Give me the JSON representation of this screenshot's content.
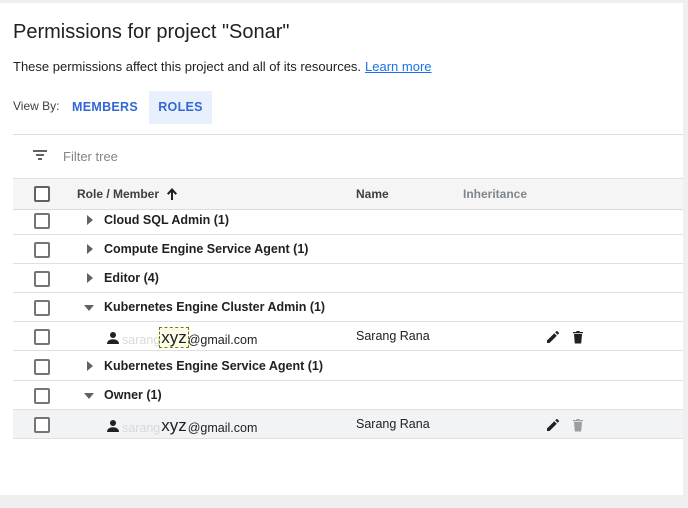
{
  "page": {
    "title": "Permissions for project \"Sonar\"",
    "subtitle": "These permissions affect this project and all of its resources.",
    "learn_more": "Learn more"
  },
  "view_by": {
    "label": "View By:",
    "tabs": [
      "MEMBERS",
      "ROLES"
    ],
    "selected": "ROLES"
  },
  "filter": {
    "placeholder": "Filter tree"
  },
  "table": {
    "columns": [
      "Role / Member",
      "Name",
      "Inheritance"
    ],
    "sort": {
      "column": "Role / Member",
      "direction": "ascending",
      "icon": "arrow-up-icon"
    }
  },
  "rows": [
    {
      "type": "role",
      "label": "Cloud SQL Admin (1)",
      "expanded": false
    },
    {
      "type": "role",
      "label": "Compute Engine Service Agent (1)",
      "expanded": false
    },
    {
      "type": "role",
      "label": "Editor (4)",
      "expanded": false
    },
    {
      "type": "role",
      "label": "Kubernetes Engine Cluster Admin (1)",
      "expanded": true
    },
    {
      "type": "member",
      "email_prefix": "sarang",
      "email_mask": "xyz",
      "email_suffix": "@gmail.com",
      "name": "Sarang Rana",
      "icons": [
        "person-icon",
        "edit-icon",
        "delete-icon"
      ]
    },
    {
      "type": "role",
      "label": "Kubernetes Engine Service Agent (1)",
      "expanded": false
    },
    {
      "type": "role",
      "label": "Owner (1)",
      "expanded": true
    },
    {
      "type": "member",
      "email_prefix": "sarang",
      "email_mask": "xyz",
      "email_suffix": "@gmail.com",
      "name": "Sarang Rana",
      "selected": true,
      "delete_disabled": true,
      "icons": [
        "person-icon",
        "edit-icon",
        "delete-icon"
      ]
    }
  ],
  "colors": {
    "accent": "#1a73e8",
    "tab_text": "#3367d6",
    "tab_selected_bg": "#e8f0fe",
    "header_bg": "#f5f5f5",
    "disabled_icon": "#9e9e9e"
  }
}
